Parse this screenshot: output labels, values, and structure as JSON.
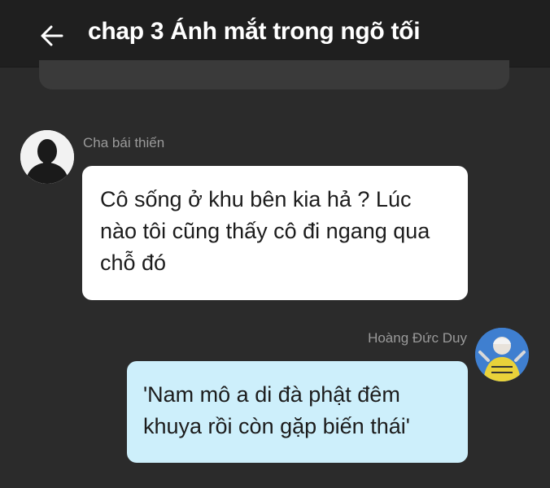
{
  "header": {
    "title": "chap 3 Ánh mắt trong ngõ tối"
  },
  "messages": [
    {
      "sender": "Cha bái thiến",
      "text": "Cô sống ở khu bên kia hả ? Lúc nào tôi cũng thấy cô đi ngang qua chỗ đó"
    },
    {
      "sender": "Hoàng Đức Duy",
      "text": "'Nam mô a di đà phật đêm khuya rồi còn gặp biến thái'"
    }
  ],
  "colors": {
    "background": "#2b2b2b",
    "header": "#1f1f1f",
    "incoming_bubble": "#ffffff",
    "outgoing_bubble": "#cdeffb",
    "sender_name": "#9a9a9a"
  },
  "icons": {
    "back": "arrow-left-icon"
  }
}
